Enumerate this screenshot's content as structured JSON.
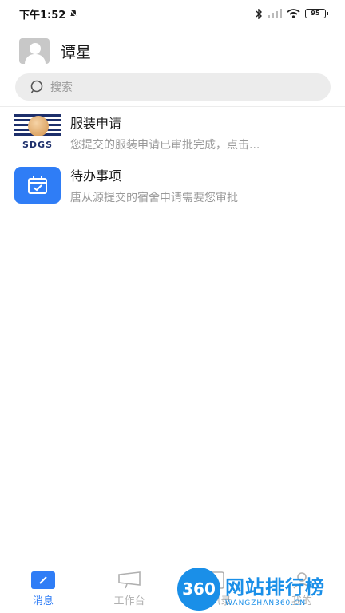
{
  "status_bar": {
    "time": "下午1:52",
    "battery": "95"
  },
  "header": {
    "username": "谭星"
  },
  "search": {
    "placeholder": "搜索"
  },
  "messages": [
    {
      "title": "服装申请",
      "preview": "您提交的服装申请已审批完成，点击...",
      "icon": "sdgs-logo",
      "logo_text": "SDGS"
    },
    {
      "title": "待办事项",
      "preview": "唐从源提交的宿舍申请需要您审批",
      "icon": "calendar-check-icon"
    }
  ],
  "tabs": [
    {
      "label": "消息",
      "icon": "message-icon",
      "active": true
    },
    {
      "label": "工作台",
      "icon": "workbench-icon",
      "active": false
    },
    {
      "label": "通讯录",
      "icon": "contacts-icon",
      "active": false
    },
    {
      "label": "我的",
      "icon": "profile-icon",
      "active": false
    }
  ],
  "watermark": {
    "badge": "360",
    "title": "网站排行榜",
    "subtitle": "WANGZHAN360.CN"
  },
  "colors": {
    "accent": "#2f7df6",
    "logo_navy": "#1d2f6b",
    "watermark": "#1a8fe8"
  }
}
